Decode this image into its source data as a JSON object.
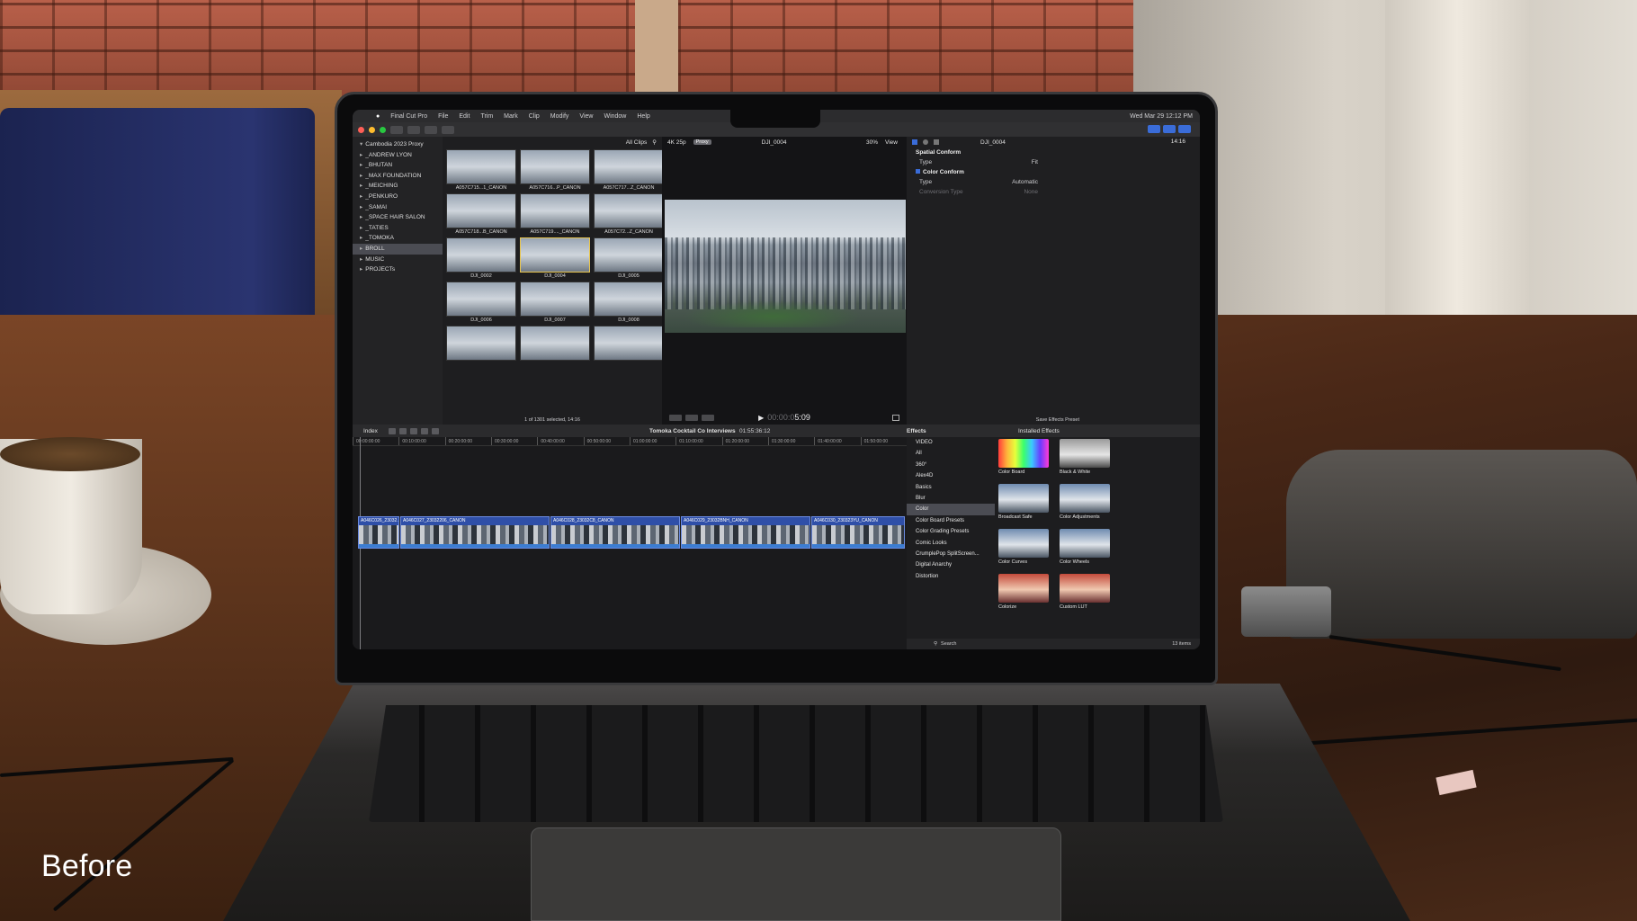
{
  "caption": "Before",
  "menubar": {
    "app": "Final Cut Pro",
    "items": [
      "File",
      "Edit",
      "Trim",
      "Mark",
      "Clip",
      "Modify",
      "View",
      "Window",
      "Help"
    ],
    "clock": "Wed Mar 29 12:12 PM"
  },
  "library": {
    "root": "Cambodia 2023 Proxy",
    "events": [
      "_ANDREW LYON",
      "_BHUTAN",
      "_MAX FOUNDATION",
      "_MEICHING",
      "_PENKURO",
      "_SAMAI",
      "_SPACE HAIR SALON",
      "_TATIES",
      "_TOMOKA",
      "BROLL",
      "MUSIC",
      "PROJECTs"
    ],
    "selected_index": 9
  },
  "browser": {
    "filter": "All Clips",
    "clips": [
      "A057C715...1_CANON",
      "A057C716...P_CANON",
      "A057C717...Z_CANON",
      "A057C718...B_CANON",
      "A057C719...._CANON",
      "A057C72...Z_CANON",
      "DJI_0002",
      "DJI_0004",
      "DJI_0005",
      "DJI_0006",
      "DJI_0007",
      "DJI_0008",
      "",
      "",
      ""
    ],
    "selected_index": 7,
    "status": "1 of 1301 selected, 14:16"
  },
  "viewer": {
    "format": "4K 25p",
    "proxy_label": "Proxy",
    "clip_name": "DJI_0004",
    "zoom": "30%",
    "view_label": "View",
    "timecode_dim": "00:00:0",
    "timecode": "5:09"
  },
  "inspector": {
    "clip_name": "DJI_0004",
    "duration": "14:16",
    "spatial_conform": "Spatial Conform",
    "type_label": "Type",
    "type_value": "Fit",
    "color_conform": "Color Conform",
    "cc_type_label": "Type",
    "cc_type_value": "Automatic",
    "conversion_label": "Conversion Type",
    "conversion_value": "None",
    "save_preset": "Save Effects Preset"
  },
  "timeline": {
    "index_label": "Index",
    "project": "Tomoka Cocktail Co Interviews",
    "project_duration": "01:55:36:12",
    "ruler": [
      "00:00:00:00",
      "00:10:00:00",
      "00:20:00:00",
      "00:30:00:00",
      "00:40:00:00",
      "00:50:00:00",
      "01:00:00:00",
      "01:10:00:00",
      "01:20:00:00",
      "01:30:00:00",
      "01:40:00:00",
      "01:50:00:00"
    ],
    "clips": [
      {
        "name": "A046C026_23032...",
        "w": 46
      },
      {
        "name": "A046C027_23032206_CANON",
        "w": 166
      },
      {
        "name": "A046C028_23032C8_CANON",
        "w": 144
      },
      {
        "name": "A046C029_23032BNH_CANON",
        "w": 144
      },
      {
        "name": "A046C030_230323YU_CANON",
        "w": 104
      }
    ]
  },
  "effects": {
    "title": "Effects",
    "installed": "Installed Effects",
    "categories": [
      "VIDEO",
      "All",
      "360°",
      "Alex4D",
      "Basics",
      "Blur",
      "Color",
      "Color Board Presets",
      "Color Grading Presets",
      "Comic Looks",
      "CrumplePop SplitScreen...",
      "Digital Anarchy",
      "Distortion"
    ],
    "selected_index": 6,
    "items": [
      {
        "name": "Color Board",
        "style": "rainbow"
      },
      {
        "name": "Black & White",
        "style": "bw"
      },
      {
        "name": "Broadcast Safe",
        "style": ""
      },
      {
        "name": "Color Adjustments",
        "style": ""
      },
      {
        "name": "Color Curves",
        "style": ""
      },
      {
        "name": "Color Wheels",
        "style": ""
      },
      {
        "name": "Colorize",
        "style": "warm"
      },
      {
        "name": "Custom LUT",
        "style": "warm"
      }
    ],
    "search_placeholder": "Search",
    "count": "13 items"
  },
  "colors": {
    "accent_blue": "#3a6cd8",
    "clip_blue": "#2f4fa8",
    "selection_yellow": "#e8c650"
  }
}
